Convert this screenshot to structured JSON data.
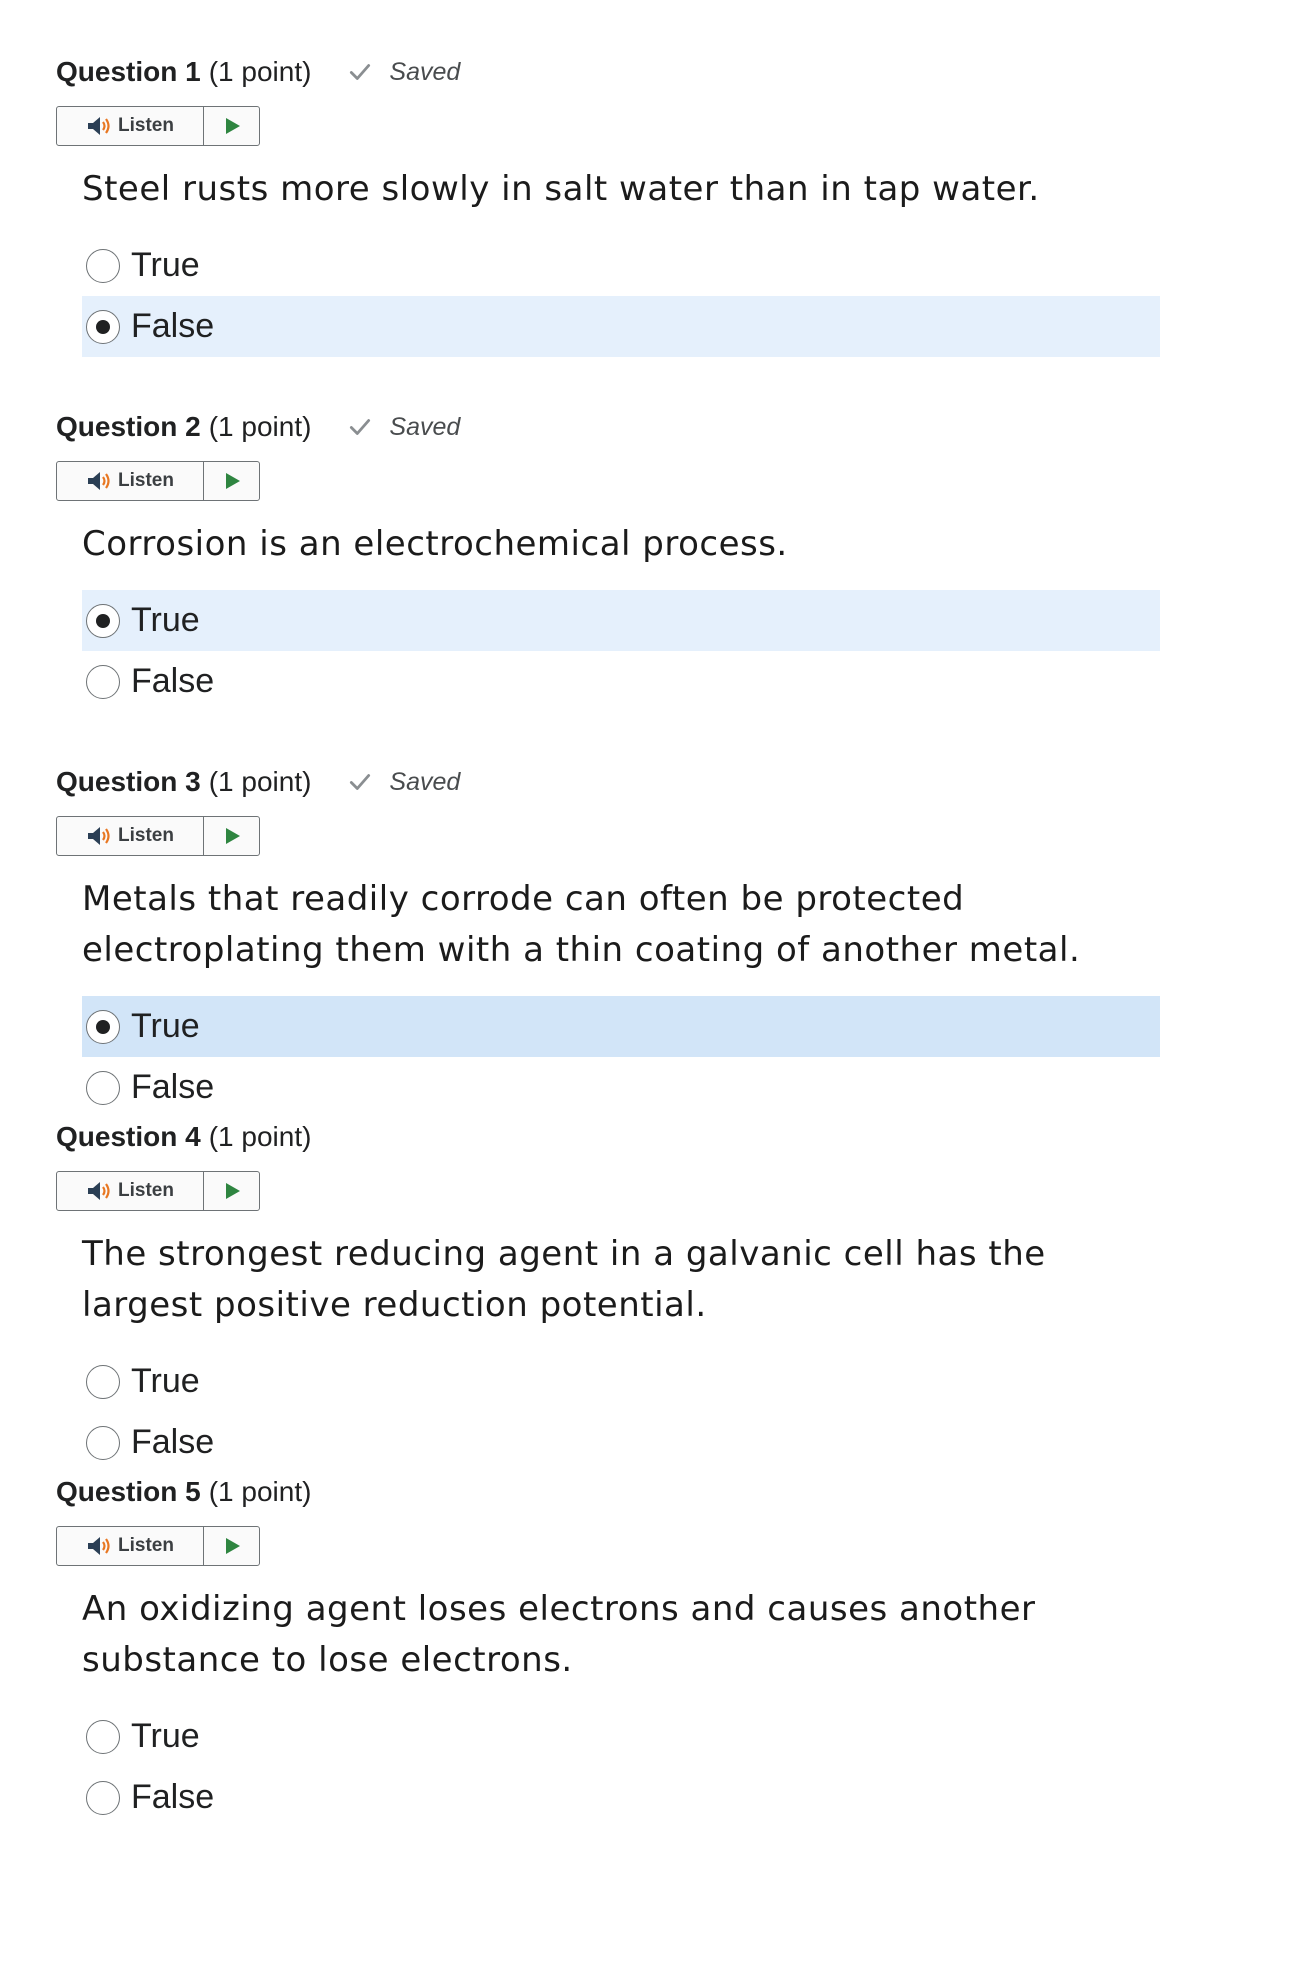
{
  "questions": [
    {
      "number": "Question 1",
      "points": "(1 point)",
      "saved": "Saved",
      "listen_label": "Listen",
      "text": "Steel rusts more slowly in salt water than in tap water.",
      "options": [
        "True",
        "False"
      ],
      "selected": "False"
    },
    {
      "number": "Question 2",
      "points": "(1 point)",
      "saved": "Saved",
      "listen_label": "Listen",
      "text": "Corrosion is an electrochemical process.",
      "options": [
        "True",
        "False"
      ],
      "selected": "True"
    },
    {
      "number": "Question 3",
      "points": "(1 point)",
      "saved": "Saved",
      "listen_label": "Listen",
      "text": "Metals that readily corrode can often be protected electroplating them with a thin coating of another metal.",
      "options": [
        "True",
        "False"
      ],
      "selected": "True"
    },
    {
      "number": "Question 4",
      "points": "(1 point)",
      "saved": "",
      "listen_label": "Listen",
      "text": "The strongest reducing agent in a galvanic cell has the largest positive reduction potential.",
      "options": [
        "True",
        "False"
      ],
      "selected": ""
    },
    {
      "number": "Question 5",
      "points": "(1 point)",
      "saved": "",
      "listen_label": "Listen",
      "text": "An oxidizing agent loses electrons and causes another substance to lose electrons.",
      "options": [
        "True",
        "False"
      ],
      "selected": ""
    }
  ],
  "icons": {
    "check": "check-icon",
    "speaker": "speaker-icon",
    "play": "play-icon"
  },
  "colors": {
    "selected_bg": "#e5f0fc",
    "play_green": "#2e8540",
    "speaker_orange": "#e87722"
  }
}
